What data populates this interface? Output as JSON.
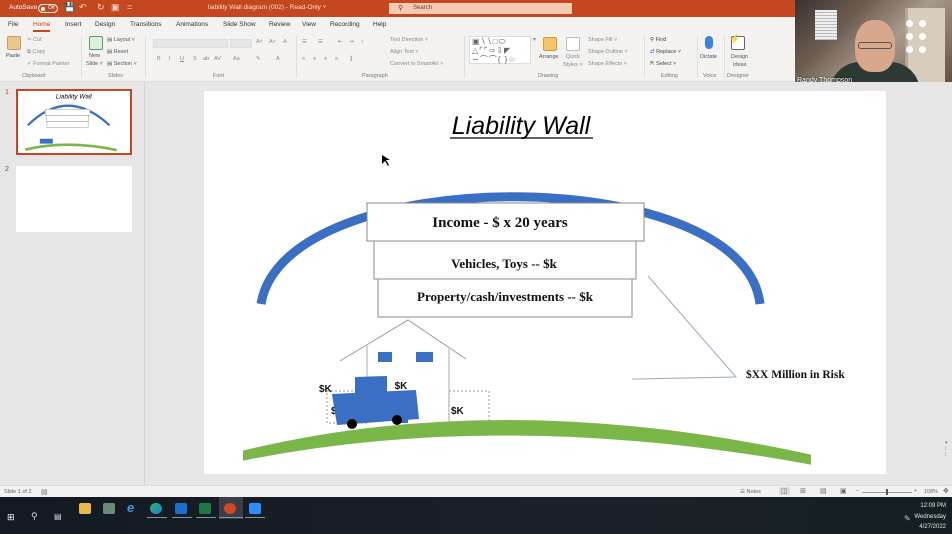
{
  "titlebar": {
    "autosave_label": "AutoSave",
    "autosave_state": "Off",
    "document_title": "liability Wall diagram (002)  -  Read-Only  ˅",
    "search_placeholder": "Search"
  },
  "tabs": [
    {
      "label": "File",
      "active": false
    },
    {
      "label": "Home",
      "active": true
    },
    {
      "label": "Insert",
      "active": false
    },
    {
      "label": "Design",
      "active": false
    },
    {
      "label": "Transitions",
      "active": false
    },
    {
      "label": "Animations",
      "active": false
    },
    {
      "label": "Slide Show",
      "active": false
    },
    {
      "label": "Review",
      "active": false
    },
    {
      "label": "View",
      "active": false
    },
    {
      "label": "Recording",
      "active": false
    },
    {
      "label": "Help",
      "active": false
    }
  ],
  "ribbon": {
    "clipboard": {
      "paste": "Paste",
      "cut": "Cut",
      "copy": "Copy",
      "format_painter": "Format Painter",
      "label": "Clipboard"
    },
    "slides": {
      "new_slide_1": "New",
      "new_slide_2": "Slide ˅",
      "layout": "Layout ˅",
      "reset": "Reset",
      "section": "Section ˅",
      "label": "Slides"
    },
    "font": {
      "bold": "B",
      "italic": "I",
      "underline": "U",
      "strike": "S",
      "shadow": "ab",
      "spacing": "AV",
      "case": "Aa",
      "grow": "A˄",
      "shrink": "A˅",
      "clear": "A",
      "label": "Font"
    },
    "paragraph": {
      "text_direction": "Text Direction ˅",
      "align_text": "Align Text ˅",
      "convert_smartart": "Convert to SmartArt ˅",
      "label": "Paragraph"
    },
    "drawing": {
      "arrange": "Arrange",
      "quick_styles_1": "Quick",
      "quick_styles_2": "Styles ˅",
      "shape_fill": "Shape Fill ˅",
      "shape_outline": "Shape Outline ˅",
      "shape_effects": "Shape Effects ˅",
      "label": "Drawing"
    },
    "editing": {
      "find": "Find",
      "replace": "Replace ˅",
      "select": "Select ˅",
      "label": "Editing"
    },
    "voice": {
      "dictate": "Dictate",
      "label": "Voice"
    },
    "designer": {
      "design_ideas_1": "Design",
      "design_ideas_2": "Ideas",
      "label": "Designer"
    }
  },
  "video": {
    "participant_name": "Randy Thompson"
  },
  "thumbnails": [
    {
      "number": "1",
      "selected": true
    },
    {
      "number": "2",
      "selected": false
    }
  ],
  "slide": {
    "title": "Liability Wall",
    "boxes": [
      "Income - $ x 20 years",
      "Vehicles, Toys -- $k",
      "Property/cash/investments -- $k"
    ],
    "risk_label": "$XX Million in Risk",
    "car_value": "$K",
    "house_value": "$K",
    "left_wing_value": "$K",
    "right_wing_value": "$K",
    "colors": {
      "wall": "#3a6fc4",
      "ground": "#7ab648",
      "house_accent": "#3a6fc4"
    }
  },
  "statusbar": {
    "slide_counter": "Slide 1 of 2",
    "notes": "Notes",
    "zoom_level": "108%",
    "zoom_minus": "−",
    "zoom_plus": "+"
  },
  "taskbar": {
    "time": "12:09 PM",
    "day": "Wednesday",
    "date": "4/27/2022"
  }
}
